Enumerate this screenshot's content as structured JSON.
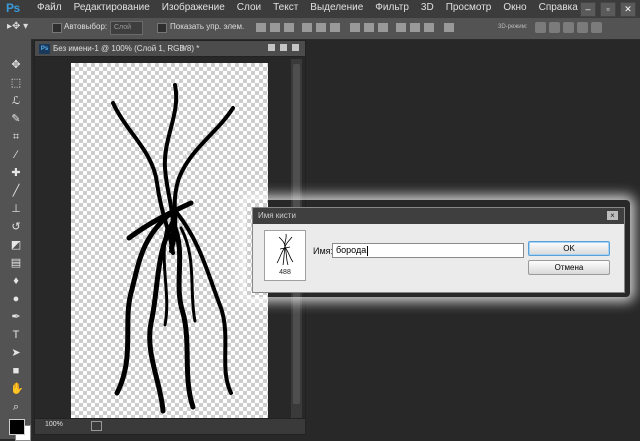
{
  "app": {
    "logo": "Ps"
  },
  "menu": [
    "Файл",
    "Редактирование",
    "Изображение",
    "Слои",
    "Текст",
    "Выделение",
    "Фильтр",
    "3D",
    "Просмотр",
    "Окно",
    "Справка"
  ],
  "window_controls": {
    "minimize": "–",
    "restore": "▫",
    "close": "✕"
  },
  "options_bar": {
    "autoselect_label": "Автовыбор:",
    "autoselect_value": "Слой",
    "show_controls_label": "Показать упр. элем.",
    "mode_3d_label": "3D-режим:"
  },
  "document": {
    "title": "Без имени-1 @ 100% (Слой 1, RGB/8) *",
    "close_glyph": "×",
    "zoom": "100%"
  },
  "dialog": {
    "title": "Имя кисти",
    "close_glyph": "×",
    "brush_size": "488",
    "name_label": "Имя:",
    "name_value": "борода",
    "ok_label": "OK",
    "cancel_label": "Отмена"
  },
  "tools": [
    "move-tool-icon",
    "marquee-tool-icon",
    "lasso-tool-icon",
    "quick-select-tool-icon",
    "crop-tool-icon",
    "eyedropper-tool-icon",
    "healing-tool-icon",
    "brush-tool-icon",
    "stamp-tool-icon",
    "history-brush-tool-icon",
    "eraser-tool-icon",
    "gradient-tool-icon",
    "blur-tool-icon",
    "dodge-tool-icon",
    "pen-tool-icon",
    "type-tool-icon",
    "path-select-tool-icon",
    "shape-tool-icon",
    "hand-tool-icon",
    "zoom-tool-icon"
  ],
  "colors": {
    "foreground": "#000000",
    "background": "#ffffff",
    "accent": "#3a9ad9"
  }
}
